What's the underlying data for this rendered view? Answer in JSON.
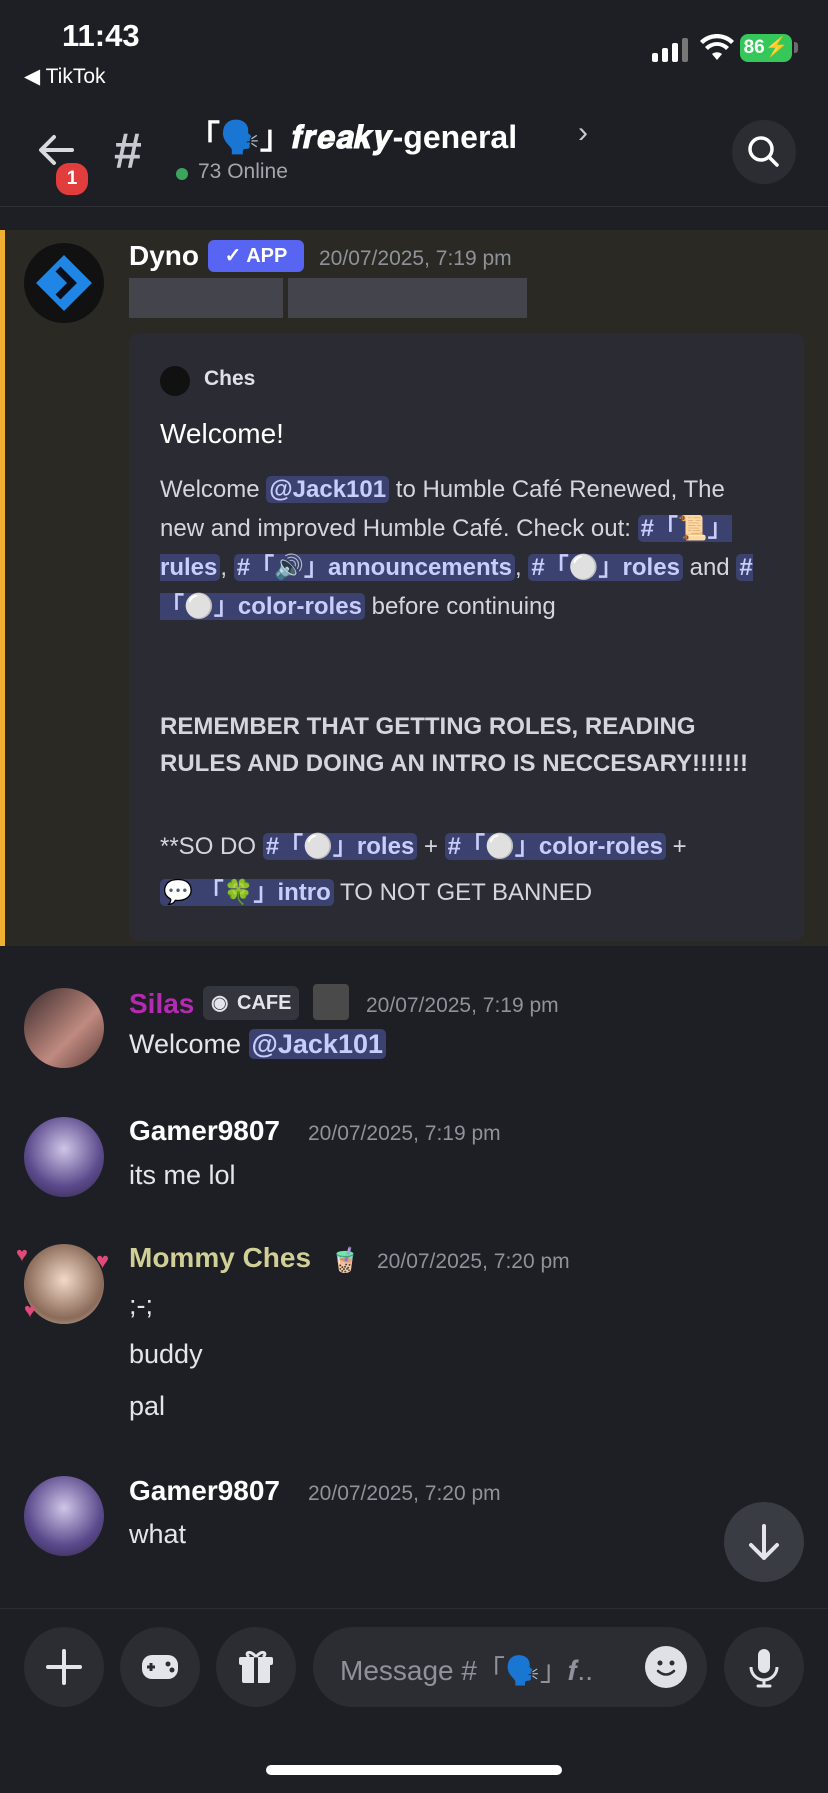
{
  "status_bar": {
    "time": "11:43",
    "back_app": "◀ TikTok",
    "battery": "86"
  },
  "header": {
    "notification_count": "1",
    "channel_hash": "#",
    "channel_name": "「🗣️」𝒇𝒓𝒆𝒂𝒌𝒚-general",
    "online": "73 Online"
  },
  "messages": {
    "dyno": {
      "author": "Dyno",
      "badge": "✓ APP",
      "timestamp": "20/07/2025, 7:19 pm",
      "embed": {
        "author": "Ches",
        "title": "Welcome!",
        "body_intro": "Welcome ",
        "mention": "@Jack101",
        "body_mid": " to Humble Café Renewed, The new and improved Humble Café. Check out: ",
        "ch_rules": "#「📜」rules",
        "ch_announcements": "#「🔊」announcements",
        "ch_roles": "#「⚪」roles",
        "and": " and ",
        "ch_color_roles": "#「⚪」color-roles",
        "body_end": " before continuing",
        "bold_text": "REMEMBER THAT GETTING ROLES, READING RULES AND DOING AN INTRO IS NECCESARY!!!!!!!",
        "so_do": "**SO DO ",
        "plus": " + ",
        "ch_intro": "「🍀」intro",
        "tail": " TO NOT GET BANNED"
      }
    },
    "silas": {
      "author": "Silas",
      "role": "CAFE",
      "timestamp": "20/07/2025, 7:19 pm",
      "text_prefix": "Welcome ",
      "mention": "@Jack101"
    },
    "gamer1": {
      "author": "Gamer9807",
      "timestamp": "20/07/2025, 7:19 pm",
      "text": "its me lol"
    },
    "ches": {
      "author": "Mommy Ches",
      "timestamp": "20/07/2025, 7:20 pm",
      "lines": [
        ";-;",
        "buddy",
        "pal"
      ]
    },
    "gamer2": {
      "author": "Gamer9807",
      "timestamp": "20/07/2025, 7:20 pm",
      "text": "what"
    }
  },
  "composer": {
    "placeholder": "Message #「🗣️」𝒇.."
  },
  "colors": {
    "accent": "#5865f2",
    "mention_bar": "#f0b132",
    "silas": "#b62ab3",
    "ches": "#cfcf96"
  }
}
